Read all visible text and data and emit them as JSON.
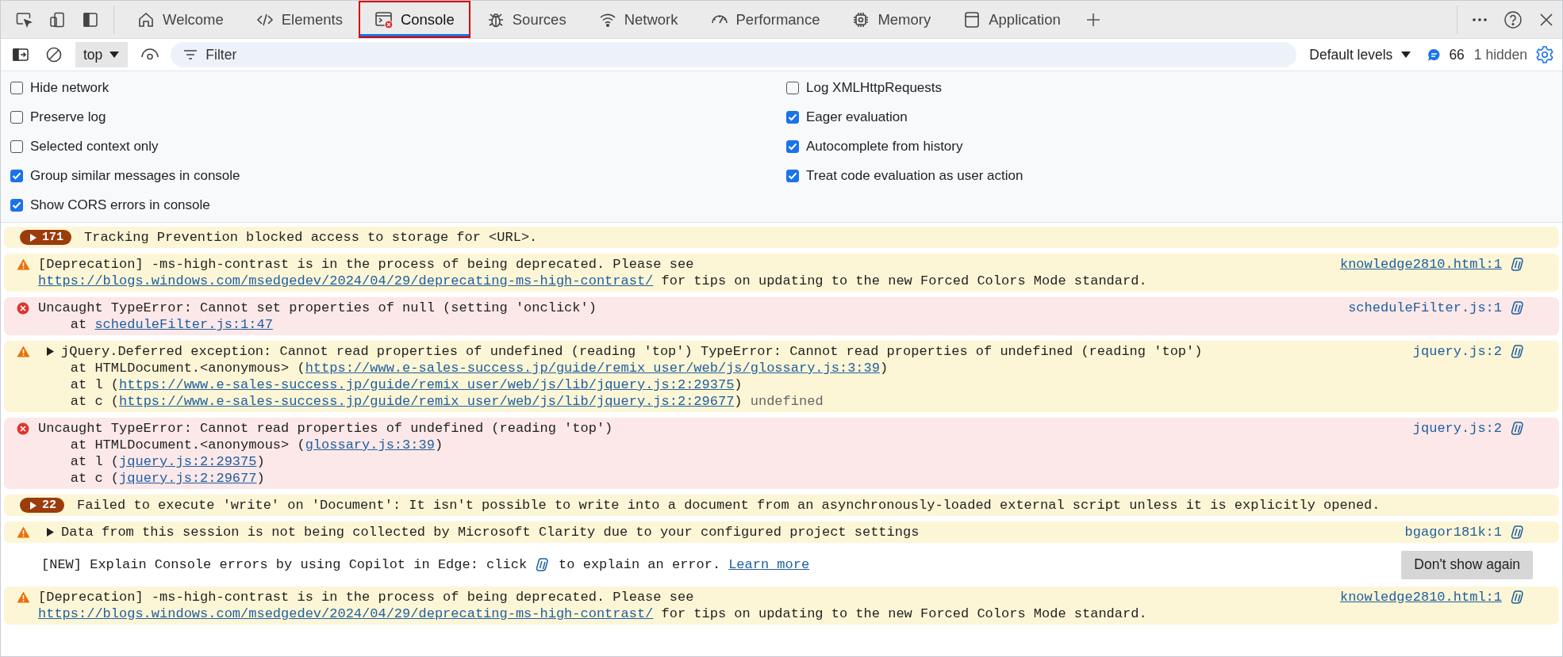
{
  "tabs": [
    {
      "label": "Welcome",
      "selected": false,
      "outlined": false
    },
    {
      "label": "Elements",
      "selected": false,
      "outlined": false
    },
    {
      "label": "Console",
      "selected": true,
      "outlined": true
    },
    {
      "label": "Sources",
      "selected": false,
      "outlined": false
    },
    {
      "label": "Network",
      "selected": false,
      "outlined": false
    },
    {
      "label": "Performance",
      "selected": false,
      "outlined": false
    },
    {
      "label": "Memory",
      "selected": false,
      "outlined": false
    },
    {
      "label": "Application",
      "selected": false,
      "outlined": false
    }
  ],
  "toolbar": {
    "context": "top",
    "filter_placeholder": "Filter",
    "levels": "Default levels",
    "issues_count": "66",
    "hidden": "1 hidden"
  },
  "settings": {
    "left": [
      {
        "label": "Hide network",
        "checked": false
      },
      {
        "label": "Preserve log",
        "checked": false
      },
      {
        "label": "Selected context only",
        "checked": false
      },
      {
        "label": "Group similar messages in console",
        "checked": true
      },
      {
        "label": "Show CORS errors in console",
        "checked": true
      }
    ],
    "right": [
      {
        "label": "Log XMLHttpRequests",
        "checked": false
      },
      {
        "label": "Eager evaluation",
        "checked": true
      },
      {
        "label": "Autocomplete from history",
        "checked": true
      },
      {
        "label": "Treat code evaluation as user action",
        "checked": true
      }
    ]
  },
  "messages": [
    {
      "kind": "warning",
      "count": "171",
      "expandable": false,
      "lines": [
        [
          {
            "text": "Tracking Prevention blocked access to storage for <URL>.",
            "kind": "plain"
          }
        ]
      ]
    },
    {
      "kind": "warning",
      "expandable": false,
      "source": "knowledge2810.html:1",
      "source_underlined": true,
      "lines": [
        [
          {
            "text": "[Deprecation] -ms-high-contrast is in the process of being deprecated. Please see",
            "kind": "plain"
          }
        ],
        [
          {
            "text": "https://blogs.windows.com/msedgedev/2024/04/29/deprecating-ms-high-contrast/",
            "kind": "link"
          },
          {
            "text": " for tips on updating to the new Forced Colors Mode standard.",
            "kind": "plain"
          }
        ]
      ]
    },
    {
      "kind": "error",
      "expandable": false,
      "source": "scheduleFilter.js:1",
      "source_underlined": false,
      "lines": [
        [
          {
            "text": "Uncaught TypeError: Cannot set properties of null (setting 'onclick')",
            "kind": "plain"
          }
        ],
        [
          {
            "text": "    at ",
            "kind": "plain"
          },
          {
            "text": "scheduleFilter.js:1:47",
            "kind": "link"
          }
        ]
      ]
    },
    {
      "kind": "warning",
      "expandable": true,
      "source": "jquery.js:2",
      "source_underlined": false,
      "lines": [
        [
          {
            "text": "jQuery.Deferred exception: Cannot read properties of undefined (reading 'top') TypeError: Cannot read properties of undefined (reading 'top')",
            "kind": "plain"
          }
        ],
        [
          {
            "text": "    at HTMLDocument.<anonymous> (",
            "kind": "plain"
          },
          {
            "text": "https://www.e-sales-success.jp/guide/remix_user/web/js/glossary.js:3:39",
            "kind": "link"
          },
          {
            "text": ")",
            "kind": "plain"
          }
        ],
        [
          {
            "text": "    at l (",
            "kind": "plain"
          },
          {
            "text": "https://www.e-sales-success.jp/guide/remix_user/web/js/lib/jquery.js:2:29375",
            "kind": "link"
          },
          {
            "text": ")",
            "kind": "plain"
          }
        ],
        [
          {
            "text": "    at c (",
            "kind": "plain"
          },
          {
            "text": "https://www.e-sales-success.jp/guide/remix_user/web/js/lib/jquery.js:2:29677",
            "kind": "link"
          },
          {
            "text": ") ",
            "kind": "plain"
          },
          {
            "text": "undefined",
            "kind": "dim"
          }
        ]
      ]
    },
    {
      "kind": "error",
      "expandable": false,
      "source": "jquery.js:2",
      "source_underlined": false,
      "lines": [
        [
          {
            "text": "Uncaught TypeError: Cannot read properties of undefined (reading 'top')",
            "kind": "plain"
          }
        ],
        [
          {
            "text": "    at HTMLDocument.<anonymous> (",
            "kind": "plain"
          },
          {
            "text": "glossary.js:3:39",
            "kind": "link"
          },
          {
            "text": ")",
            "kind": "plain"
          }
        ],
        [
          {
            "text": "    at l (",
            "kind": "plain"
          },
          {
            "text": "jquery.js:2:29375",
            "kind": "link"
          },
          {
            "text": ")",
            "kind": "plain"
          }
        ],
        [
          {
            "text": "    at c (",
            "kind": "plain"
          },
          {
            "text": "jquery.js:2:29677",
            "kind": "link"
          },
          {
            "text": ")",
            "kind": "plain"
          }
        ]
      ]
    },
    {
      "kind": "warning",
      "count": "22",
      "expandable": false,
      "lines": [
        [
          {
            "text": "Failed to execute 'write' on 'Document': It isn't possible to write into a document from an asynchronously-loaded external script unless it is explicitly opened.",
            "kind": "plain"
          }
        ]
      ]
    },
    {
      "kind": "warning",
      "expandable": true,
      "source": "bgagor181k:1",
      "source_underlined": false,
      "lines": [
        [
          {
            "text": "Data from this session is not being collected by Microsoft Clarity due to your configured project settings",
            "kind": "plain"
          }
        ]
      ]
    },
    {
      "kind": "notice",
      "text_before": "[NEW] Explain Console errors by using Copilot in Edge: click",
      "text_after": "to explain an error.",
      "link": "Learn more",
      "button": "Don't show again"
    },
    {
      "kind": "warning",
      "expandable": false,
      "source": "knowledge2810.html:1",
      "source_underlined": true,
      "lines": [
        [
          {
            "text": "[Deprecation] -ms-high-contrast is in the process of being deprecated. Please see",
            "kind": "plain"
          }
        ],
        [
          {
            "text": "https://blogs.windows.com/msedgedev/2024/04/29/deprecating-ms-high-contrast/",
            "kind": "link"
          },
          {
            "text": " for tips on updating to the new Forced Colors Mode standard.",
            "kind": "plain"
          }
        ]
      ]
    }
  ]
}
